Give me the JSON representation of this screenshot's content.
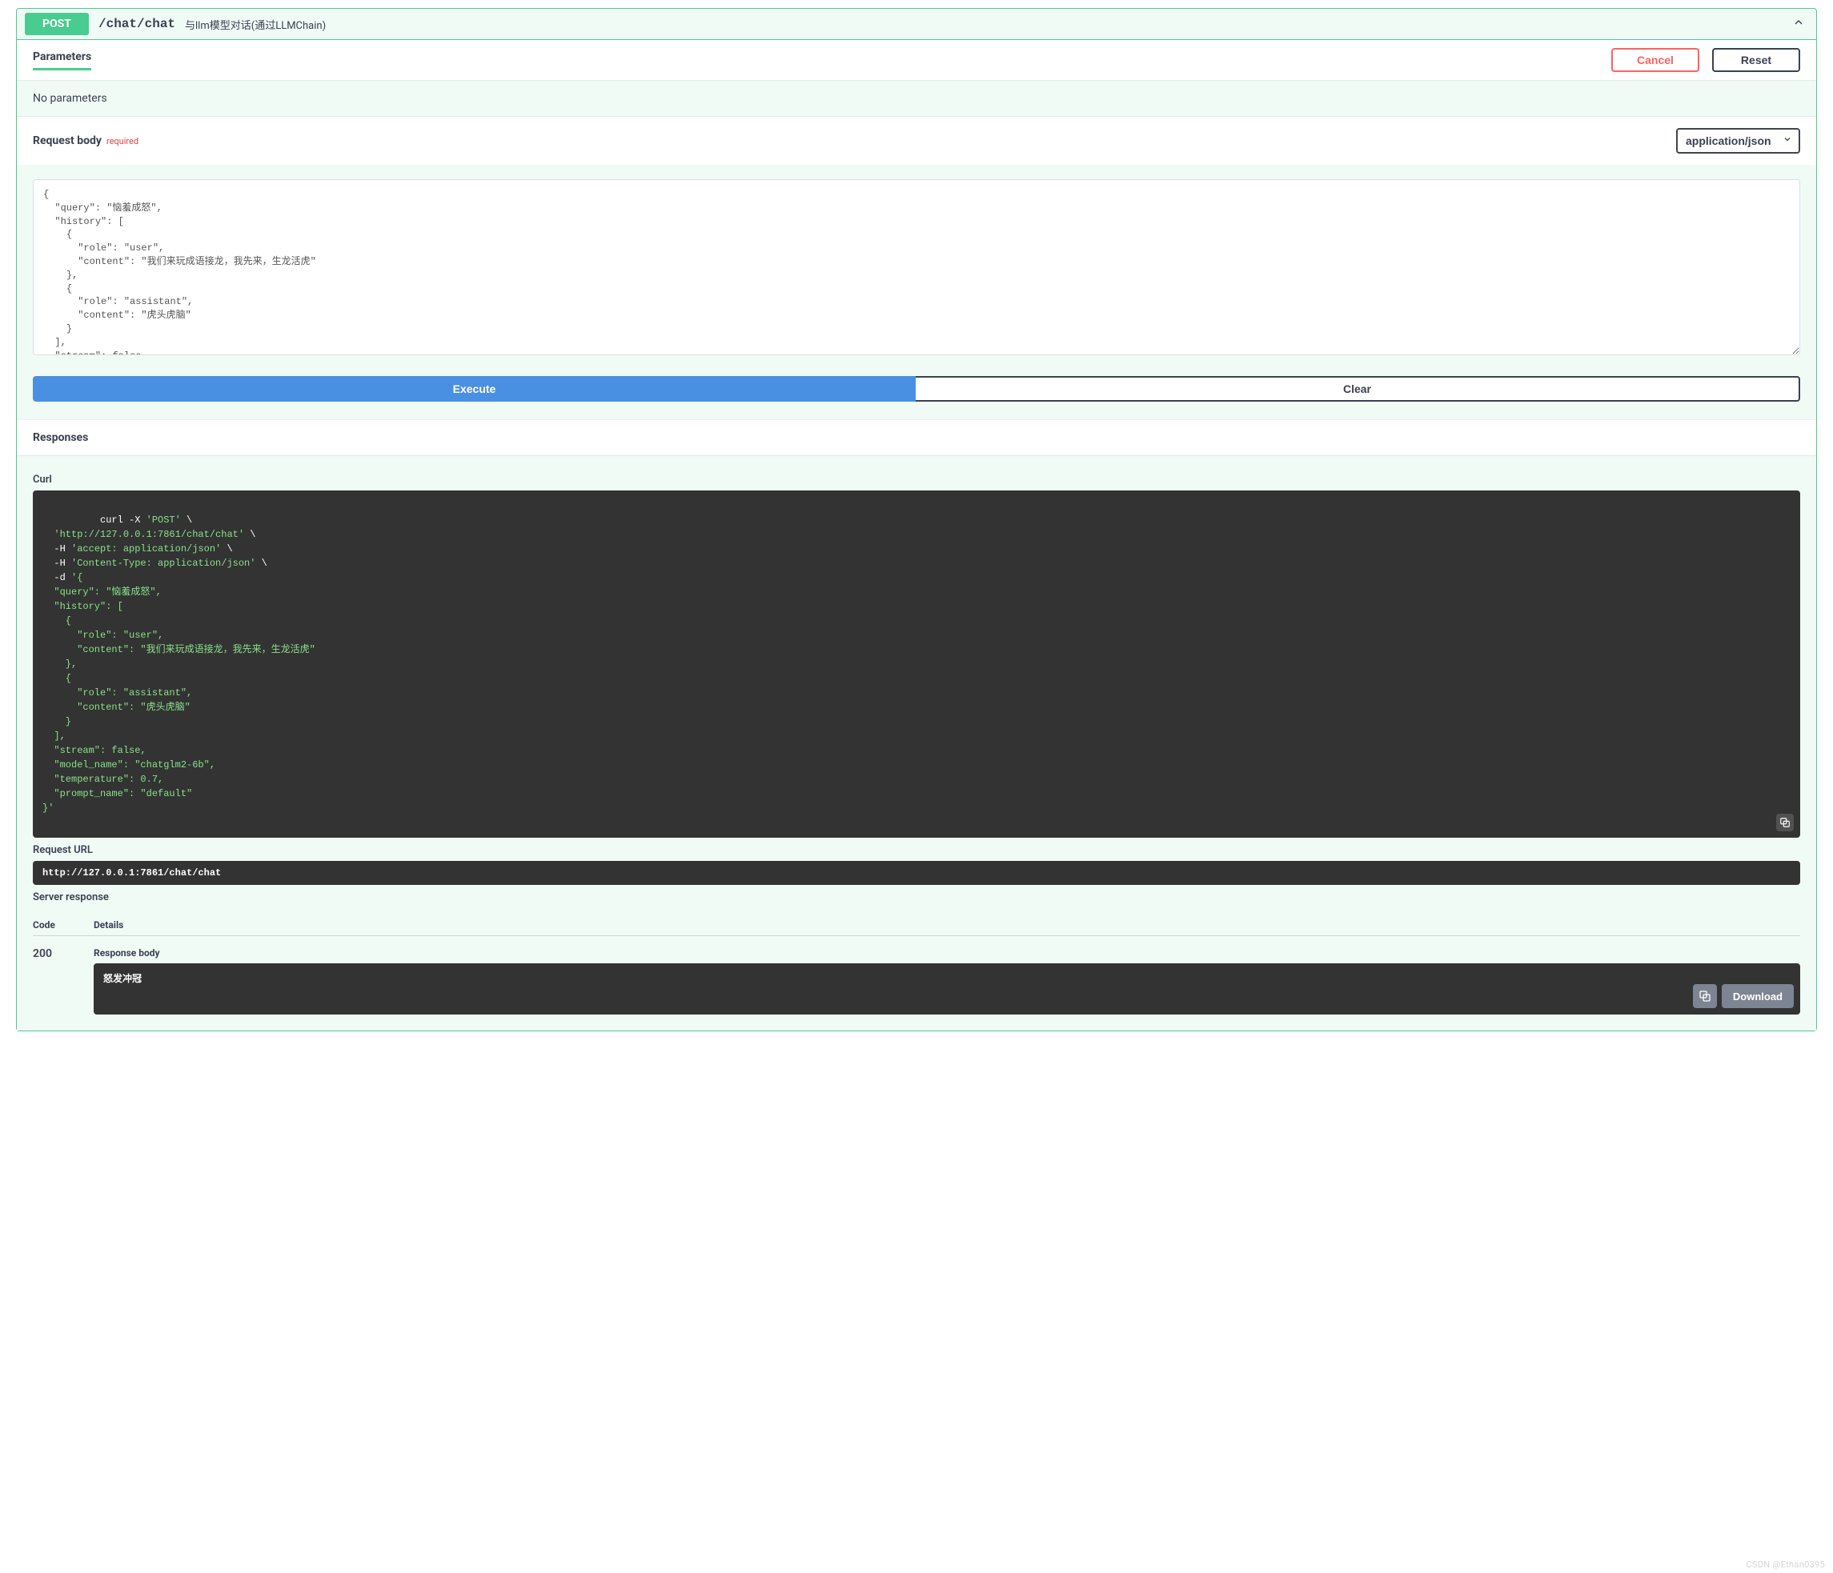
{
  "op": {
    "method": "POST",
    "path": "/chat/chat",
    "summary": "与llm模型对话(通过LLMChain)"
  },
  "params": {
    "tab_label": "Parameters",
    "cancel": "Cancel",
    "reset": "Reset",
    "no_params": "No parameters"
  },
  "request_body": {
    "label": "Request body",
    "required": "required",
    "content_type_selected": "application/json",
    "editor_value": "{\n  \"query\": \"恼羞成怒\",\n  \"history\": [\n    {\n      \"role\": \"user\",\n      \"content\": \"我们来玩成语接龙，我先来，生龙活虎\"\n    },\n    {\n      \"role\": \"assistant\",\n      \"content\": \"虎头虎脑\"\n    }\n  ],\n  \"stream\": false,\n  \"model_name\": \"chatglm2-6b\",\n  \"temperature\": 0.7,\n  \"prompt_name\": \"default\"\n}"
  },
  "exec": {
    "execute": "Execute",
    "clear": "Clear"
  },
  "responses": {
    "label": "Responses",
    "curl_label": "Curl",
    "curl_tokens": [
      {
        "t": "curl -X ",
        "c": "w"
      },
      {
        "t": "'POST'",
        "c": "g"
      },
      {
        "t": " \\\n  ",
        "c": "w"
      },
      {
        "t": "'http://127.0.0.1:7861/chat/chat'",
        "c": "g"
      },
      {
        "t": " \\\n  -H ",
        "c": "w"
      },
      {
        "t": "'accept: application/json'",
        "c": "g"
      },
      {
        "t": " \\\n  -H ",
        "c": "w"
      },
      {
        "t": "'Content-Type: application/json'",
        "c": "g"
      },
      {
        "t": " \\\n  -d ",
        "c": "w"
      },
      {
        "t": "'{\n  \"query\": \"恼羞成怒\",\n  \"history\": [\n    {\n      \"role\": \"user\",\n      \"content\": \"我们来玩成语接龙，我先来，生龙活虎\"\n    },\n    {\n      \"role\": \"assistant\",\n      \"content\": \"虎头虎脑\"\n    }\n  ],\n  \"stream\": false,\n  \"model_name\": \"chatglm2-6b\",\n  \"temperature\": 0.7,\n  \"prompt_name\": \"default\"\n}'",
        "c": "g"
      }
    ],
    "request_url_label": "Request URL",
    "request_url": "http://127.0.0.1:7861/chat/chat",
    "server_response_label": "Server response",
    "code_header": "Code",
    "details_header": "Details",
    "code": "200",
    "response_body_label": "Response body",
    "response_body": "怒发冲冠",
    "download": "Download"
  },
  "watermark": "CSDN @Ethan0395"
}
